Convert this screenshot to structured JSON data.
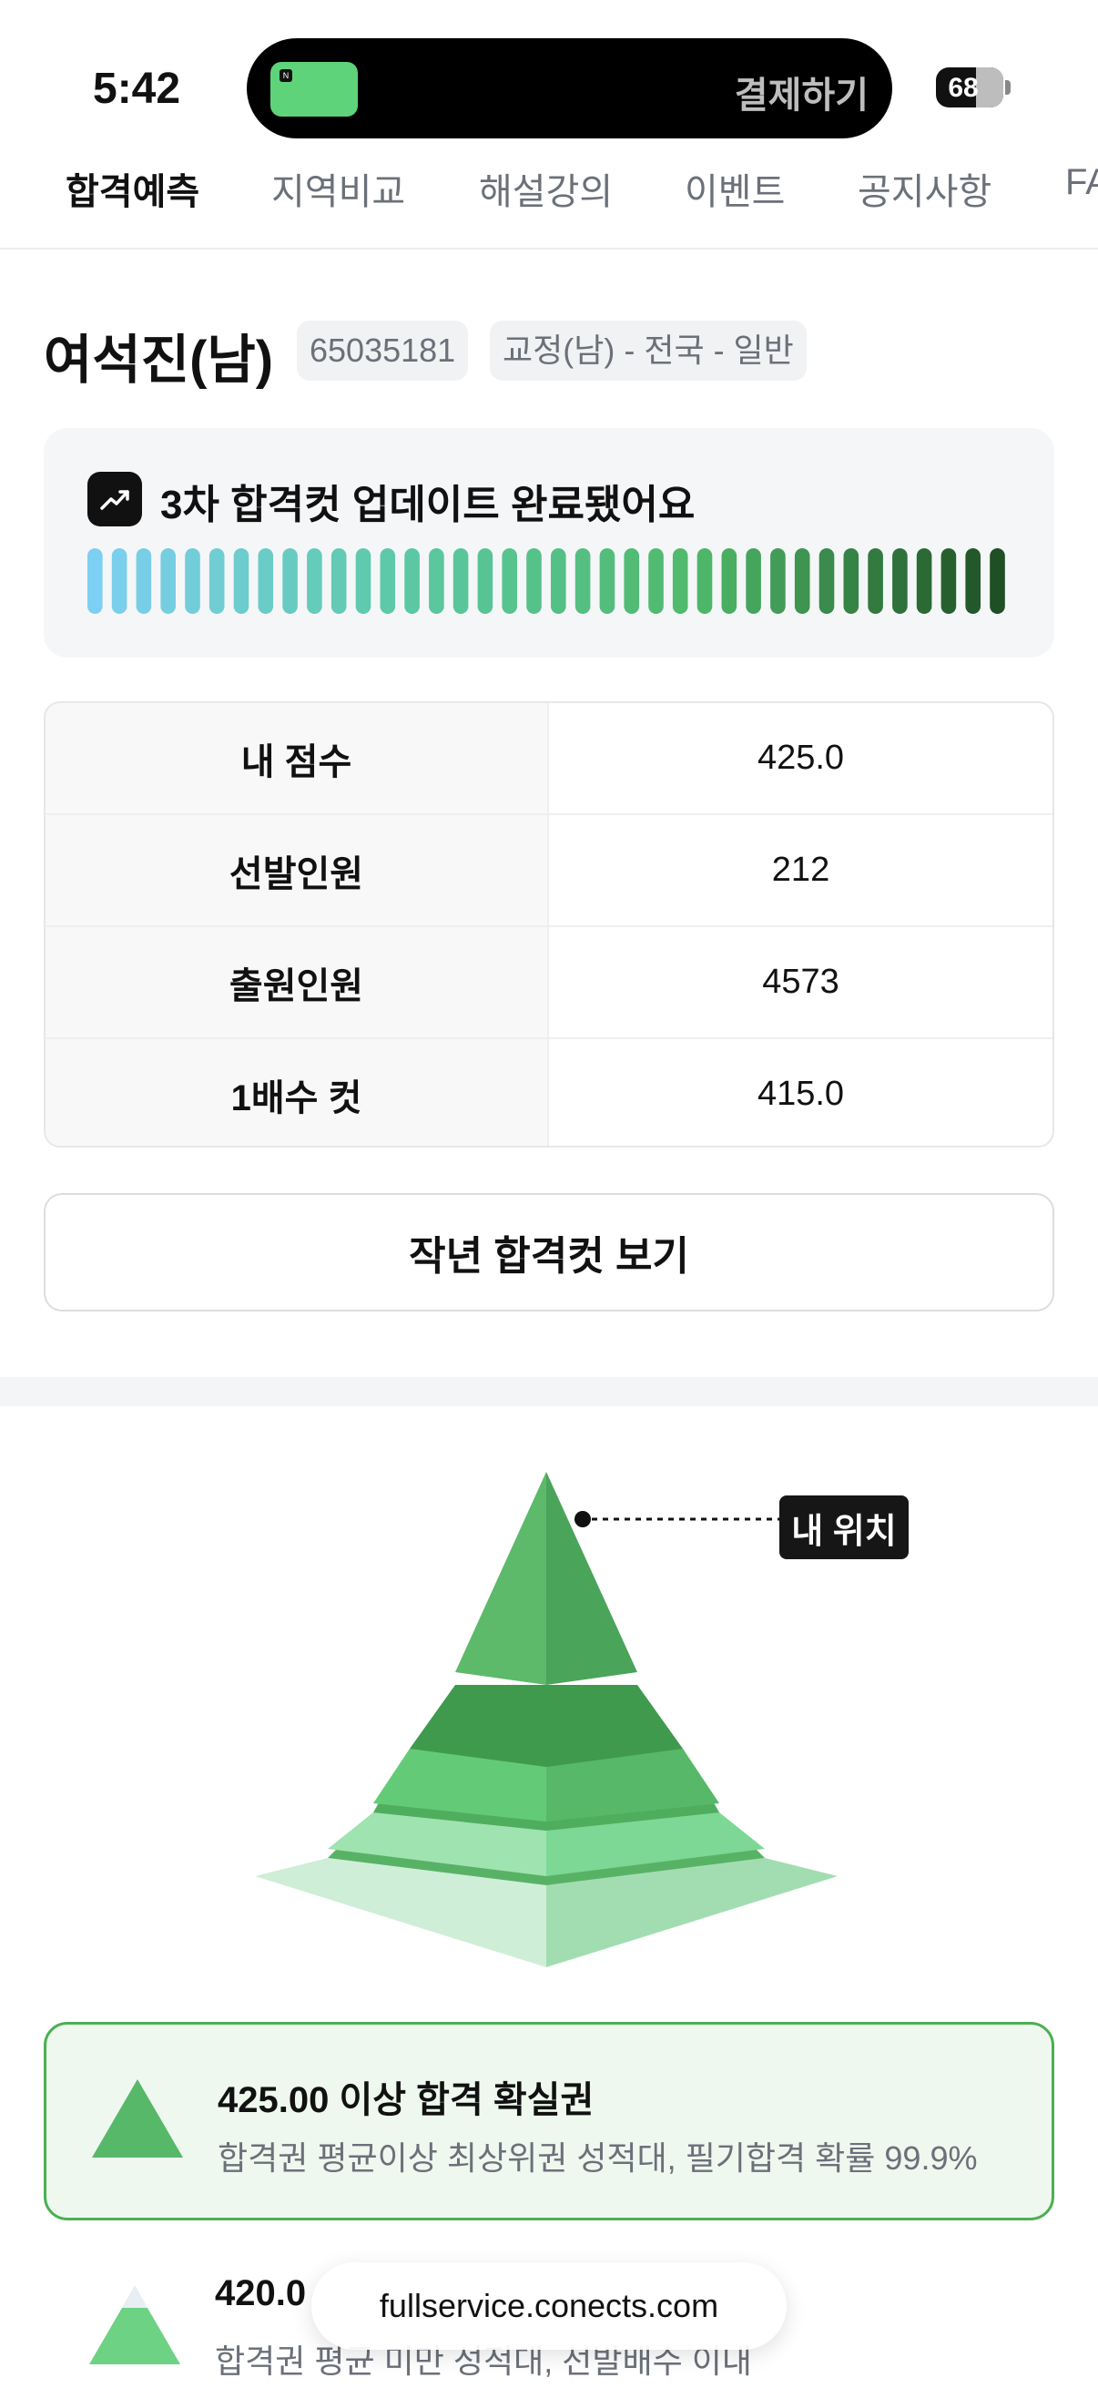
{
  "status_bar": {
    "time": "5:42",
    "island_text": "결제하기",
    "battery": "68"
  },
  "tabs": [
    {
      "label": "합격예측",
      "active": true
    },
    {
      "label": "지역비교"
    },
    {
      "label": "해설강의"
    },
    {
      "label": "이벤트"
    },
    {
      "label": "공지사항"
    },
    {
      "label": "FAQ"
    }
  ],
  "profile": {
    "name": "여석진(남)",
    "id": "65035181",
    "category": "교정(남) - 전국 - 일반"
  },
  "update": {
    "title": "3차 합격컷 업데이트 완료됐어요",
    "segment_count": 38,
    "colors": [
      "#7dcff3",
      "#5cc9a6",
      "#4fb96a",
      "#1f4f24"
    ]
  },
  "score_table": [
    {
      "label": "내 점수",
      "value": "425.0"
    },
    {
      "label": "선발인원",
      "value": "212"
    },
    {
      "label": "출원인원",
      "value": "4573"
    },
    {
      "label": "1배수 컷",
      "value": "415.0"
    }
  ],
  "last_year_button": "작년 합격컷 보기",
  "pyramid": {
    "my_position_label": "내 위치",
    "my_tier": 1
  },
  "tiers": [
    {
      "title": "425.00 이상 합격 확실권",
      "desc": "합격권 평균이상 최상위권 성적대, 필기합격 확률 99.9%",
      "active": true
    },
    {
      "title": "420.0",
      "desc": "합격권 평균 미만 성적대, 선발배수 이내",
      "active": false
    }
  ],
  "browser": {
    "url": "fullservice.conects.com"
  }
}
